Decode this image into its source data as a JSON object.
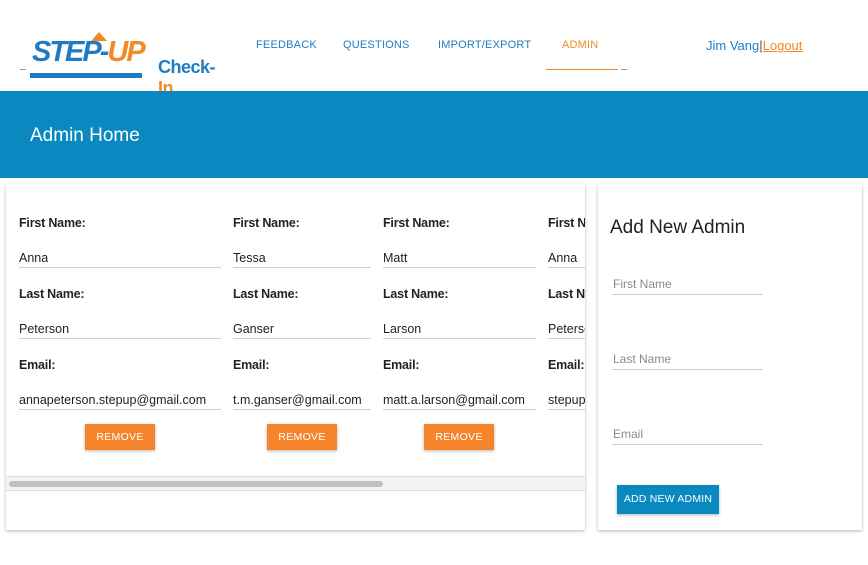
{
  "logo": {
    "step": "STEP",
    "dash": "-",
    "up": "UP",
    "checkin": "Check-",
    "checkin_in": "In"
  },
  "nav": {
    "items": [
      {
        "label": "FEEDBACK"
      },
      {
        "label": "QUESTIONS"
      },
      {
        "label": "IMPORT/EXPORT"
      },
      {
        "label": "ADMIN"
      }
    ],
    "active": "ADMIN"
  },
  "user": {
    "name": "Jim Vang",
    "separator": "|",
    "logout": "Logout"
  },
  "banner": {
    "title": "Admin Home"
  },
  "admins": {
    "first_label": "First Name:",
    "last_label": "Last Name:",
    "email_label": "Email:",
    "remove_label": "REMOVE",
    "list": [
      {
        "first": "Anna",
        "last": "Peterson",
        "email": "annapeterson.stepup@gmail.com"
      },
      {
        "first": "Tessa",
        "last": "Ganser",
        "email": "t.m.ganser@gmail.com"
      },
      {
        "first": "Matt",
        "last": "Larson",
        "email": "matt.a.larson@gmail.com"
      },
      {
        "first": "Anna",
        "last": "Peterson",
        "email": "stepup"
      }
    ]
  },
  "add_admin": {
    "title": "Add New Admin",
    "first_placeholder": "First Name",
    "last_placeholder": "Last Name",
    "email_placeholder": "Email",
    "button": "ADD NEW ADMIN"
  },
  "colors": {
    "brand_blue": "#0a88c0",
    "accent_orange": "#f5842c"
  }
}
